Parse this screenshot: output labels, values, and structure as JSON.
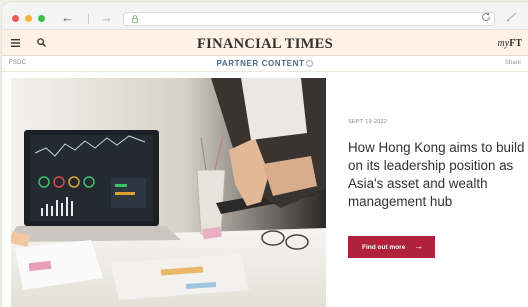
{
  "browser": {
    "back_icon": "arrow-left-icon",
    "forward_icon": "arrow-right-icon",
    "back_glyph": "←",
    "forward_glyph": "→",
    "lock_icon": "lock-icon",
    "reload_icon": "reload-icon",
    "extension_icon": "pen-icon"
  },
  "header": {
    "masthead": "FINANCIAL TIMES",
    "myft_my": "my",
    "myft_ft": "FT",
    "menu_icon": "hamburger-icon",
    "search_icon": "search-icon",
    "background": "#fff1e5"
  },
  "subbar": {
    "sponsor": "FSDC",
    "partner_label": "PARTNER CONTENT",
    "share_label": "Share"
  },
  "hero": {
    "image_icon": "laptop-trading-chart-image"
  },
  "article": {
    "date": "SEPT 19 2022",
    "headline": "How Hong Kong aims to build on its leadership position as Asia's asset and wealth management hub",
    "cta_label": "Find out more",
    "cta_arrow": "→",
    "cta_color": "#b0213b"
  }
}
